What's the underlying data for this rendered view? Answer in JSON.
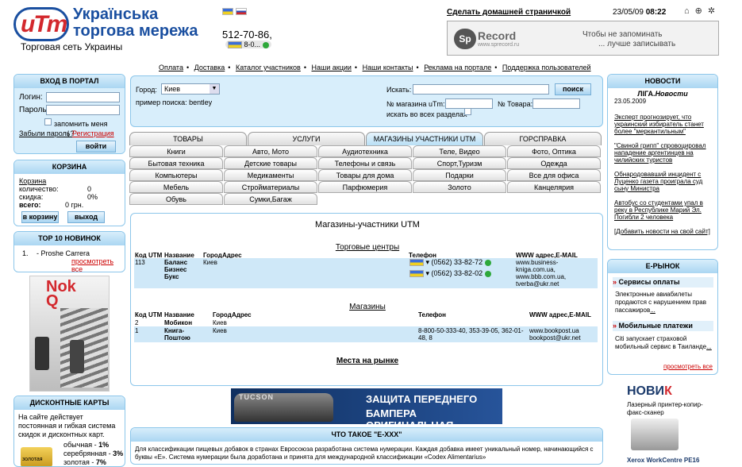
{
  "header": {
    "logo_mark": "uTm",
    "logo_title": "Українська торгова мережа",
    "logo_subtitle": "Торговая сеть Украины",
    "phone": "512-70-86,",
    "phone2": "8-0...",
    "set_home": "Сделать домашней страничкой",
    "date": "23/05/09",
    "time": "08:22",
    "icons": [
      "home-icon",
      "target-icon",
      "star-icon"
    ]
  },
  "banner": {
    "logo": "Sp",
    "name": "Record",
    "url": "www.sprecord.ru",
    "line1": "Чтобы не запоминать",
    "line2": "... лучше записывать"
  },
  "topnav": [
    "Оплата",
    "Доставка",
    "Каталог участников",
    "Наши акции",
    "Наши контакты",
    "Реклама на портале",
    "Поддержка пользователей"
  ],
  "login": {
    "title": "ВХОД В ПОРТАЛ",
    "login_label": "Логин:",
    "password_label": "Пароль:",
    "remember": "запомнить меня",
    "forgot": "Забыли пароль?",
    "sep": "|",
    "register": "Регистрация",
    "submit": "войти"
  },
  "cart": {
    "title": "КОРЗИНА",
    "link": "Корзина",
    "qty_label": "количество:",
    "qty": "0",
    "disc_label": "скидка:",
    "disc": "0%",
    "total_label": "всего:",
    "total": "0 грн.",
    "to_cart": "в корзину",
    "exit": "выход"
  },
  "top10": {
    "title": "TOP 10 НОВИНОК",
    "item_num": "1.",
    "item": "- Proshe Carrera",
    "all": "просмотреть все"
  },
  "ad_left": {
    "brand": "Nok",
    "brand2": "Q"
  },
  "discount": {
    "title": "ДИСКОНТНЫЕ КАРТЫ",
    "text": "На сайте действует постоянная и гибкая система скидок и дисконтных карт.",
    "l1": "обычная - ",
    "v1": "1%",
    "l2": "серебрянная - ",
    "v2": "3%",
    "l3": "золотая - ",
    "v3": "7%",
    "card": "золотая"
  },
  "search": {
    "city_label": "Город:",
    "city": "Киев",
    "example": "пример поиска: bentley",
    "search_label": "Искать:",
    "search_btn": "поиск",
    "shop_label": "№ магазина uTm:",
    "product_label": "№ Товара:",
    "all_sections": "искать во всех разделах"
  },
  "tabs": [
    "ТОВАРЫ",
    "УСЛУГИ",
    "МАГАЗИНЫ УЧАСТНИКИ UTM",
    "ГОРСПРАВКА"
  ],
  "subcats": [
    "Книги",
    "Авто, Мото",
    "Аудиотехника",
    "Теле, Видео",
    "Фото, Оптика",
    "Бытовая техника",
    "Детские товары",
    "Телефоны и связь",
    "Спорт,Туризм",
    "Одежда",
    "Компьютеры",
    "Медикаменты",
    "Товары для дома",
    "Подарки",
    "Все для офиса",
    "Мебель",
    "Стройматериалы",
    "Парфюмерия",
    "Золото",
    "Канцелярия",
    "Обувь",
    "Сумки,Багаж"
  ],
  "shops": {
    "title": "Магазины-участники UTM",
    "sec1": "Торговые центры",
    "sec2": "Магазины",
    "sec3": "Места на рынке",
    "h_code": "Код UTM",
    "h_name": "Название",
    "h_city": "Город",
    "h_addr": "Адрес",
    "h_phone": "Телефон",
    "h_www": "WWW адрес,E-MAIL",
    "r1": {
      "code": "113",
      "name": "Баланс Бизнес Букс",
      "city": "Киев",
      "ph1": "(0562) 33-82-72",
      "ph2": "(0562) 33-82-02",
      "www": "www.business-kniga.com.ua, www.bbb.com.ua, tverba@ukr.net"
    },
    "r2": {
      "code": "2",
      "name": "Мобикон",
      "city": "Киев"
    },
    "r3": {
      "code": "1",
      "name": "Книга-Поштою",
      "city": "Киев",
      "phone": "8-800-50-333-40, 353-39-05, 362-01-48, 8",
      "www": "www.bookpost.ua bookpost@ukr.net"
    }
  },
  "mid_banner": {
    "brand": "TUCSON",
    "line1": "ЗАЩИТА ПЕРЕДНЕГО",
    "line2": "БАМПЕРА ОРИГИНАЛЬНАЯ"
  },
  "exxx": {
    "title": "ЧТО ТАКОЕ \"Е-XXX\"",
    "text": "Для классификации пищевых добавок в странах Евросоюза разработана система нумерации. Каждая добавка имеет уникальный номер, начинающийся с буквы «Е». Система нумерации была доработана и принята для международной классификации «Codex Alimentarius»"
  },
  "news": {
    "title": "НОВОСТИ",
    "source": "ЛІГА.",
    "source2": "Новости",
    "date": "23.05.2009",
    "items": [
      "Эксперт прогнозирует, что украинский избиратель станет более \"меркантильным\"",
      "\"Свиной грипп\" спровоцировал нападение аргентинцев на чилийских туристов",
      "Обнародовавший инцидент с Луценко газета проиграла суд сыну Министра",
      "Автобус со студентами упал в реку в Республике Марий Эл. Погибли 2 человека"
    ],
    "add": "[Добавить новости на свой сайт]"
  },
  "emarket": {
    "title": "Е-РЫНОК",
    "s1": "Сервисы оплаты",
    "t1": "Электронные авиабилеты продаются с нарушением прав пассажиров",
    "s2": "Мобильные платежи",
    "t2": "Citi запускает страховой мобильный сервис в Таиланде",
    "all": "просмотреть все"
  },
  "ad_right": {
    "brand": "НОВИ",
    "brand2": "К",
    "text": "Лазерный принтер-копир-факс-сканер",
    "model": "Xerox WorkCentre PE16"
  }
}
